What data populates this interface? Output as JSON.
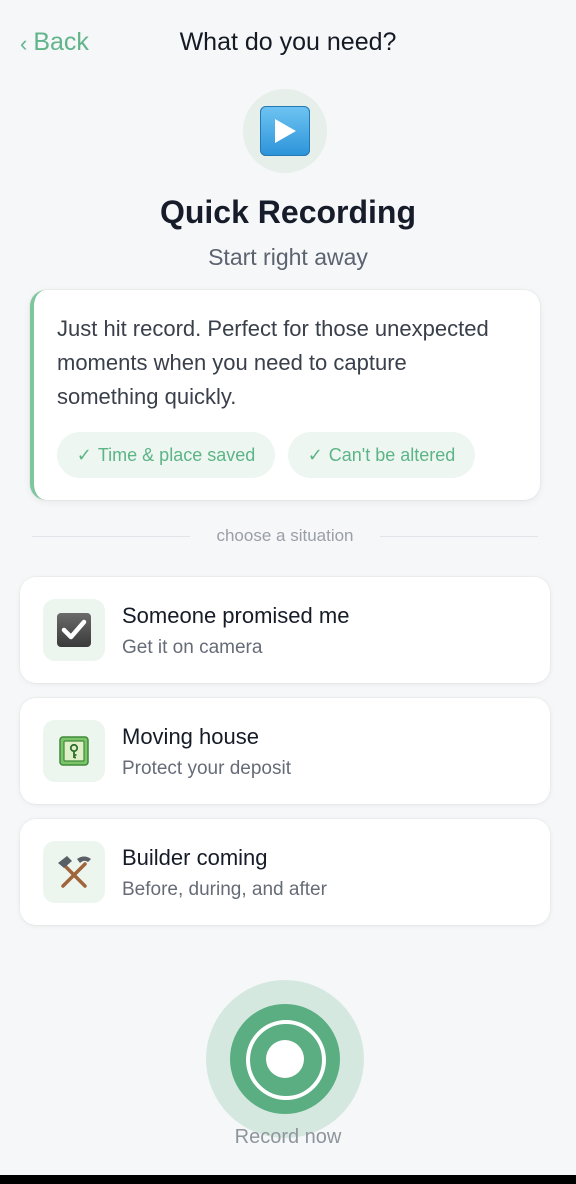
{
  "header": {
    "back_label": "Back",
    "title": "What do you need?"
  },
  "hero": {
    "icon": "play-button-icon",
    "title": "Quick Recording",
    "subtitle": "Start right away"
  },
  "info_card": {
    "text": "Just hit record. Perfect for those unexpected moments when you need to capture something quickly.",
    "badges": [
      {
        "check": "✓",
        "label": "Time & place saved"
      },
      {
        "check": "✓",
        "label": "Can't be altered"
      }
    ]
  },
  "divider": {
    "label": "choose a situation"
  },
  "situations": [
    {
      "icon": "check-box-icon",
      "title": "Someone promised me",
      "subtitle": "Get it on camera"
    },
    {
      "icon": "key-icon",
      "title": "Moving house",
      "subtitle": "Protect your deposit"
    },
    {
      "icon": "hammer-pick-icon",
      "title": "Builder coming",
      "subtitle": "Before, during, and after"
    }
  ],
  "record": {
    "label": "Record now"
  },
  "colors": {
    "accent": "#62b58a",
    "background": "#f5f7f8",
    "badge_bg": "#edf6f0"
  }
}
